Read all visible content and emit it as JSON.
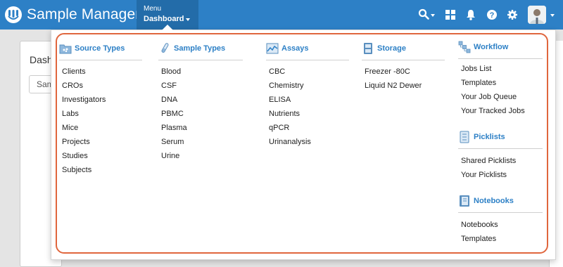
{
  "app": {
    "title": "Sample Manager"
  },
  "nav": {
    "menu_small": "Menu",
    "menu_main": "Dashboard"
  },
  "background": {
    "card_title": "Dash",
    "select_text": "Sam"
  },
  "sections": {
    "source_types": {
      "label": "Source Types",
      "items": [
        "Clients",
        "CROs",
        "Investigators",
        "Labs",
        "Mice",
        "Projects",
        "Studies",
        "Subjects"
      ]
    },
    "sample_types": {
      "label": "Sample Types",
      "items": [
        "Blood",
        "CSF",
        "DNA",
        "PBMC",
        "Plasma",
        "Serum",
        "Urine"
      ]
    },
    "assays": {
      "label": "Assays",
      "items": [
        "CBC",
        "Chemistry",
        "ELISA",
        "Nutrients",
        "qPCR",
        "Urinanalysis"
      ]
    },
    "storage": {
      "label": "Storage",
      "items": [
        "Freezer -80C",
        "Liquid N2 Dewer"
      ]
    },
    "workflow": {
      "label": "Workflow",
      "items": [
        "Jobs List",
        "Templates",
        "Your Job Queue",
        "Your Tracked Jobs"
      ]
    },
    "picklists": {
      "label": "Picklists",
      "items": [
        "Shared Picklists",
        "Your Picklists"
      ]
    },
    "notebooks": {
      "label": "Notebooks",
      "items": [
        "Notebooks",
        "Templates"
      ]
    }
  },
  "colors": {
    "header": "#2d80c6",
    "menu_active": "#236ca9",
    "link": "#2d80c6",
    "highlight": "#e0663d"
  },
  "icons": [
    "logo-icon",
    "search-icon",
    "grid-icon",
    "bell-icon",
    "help-icon",
    "gear-icon",
    "avatar",
    "source-types-icon",
    "sample-types-icon",
    "assays-icon",
    "storage-icon",
    "workflow-icon",
    "picklists-icon",
    "notebooks-icon"
  ]
}
